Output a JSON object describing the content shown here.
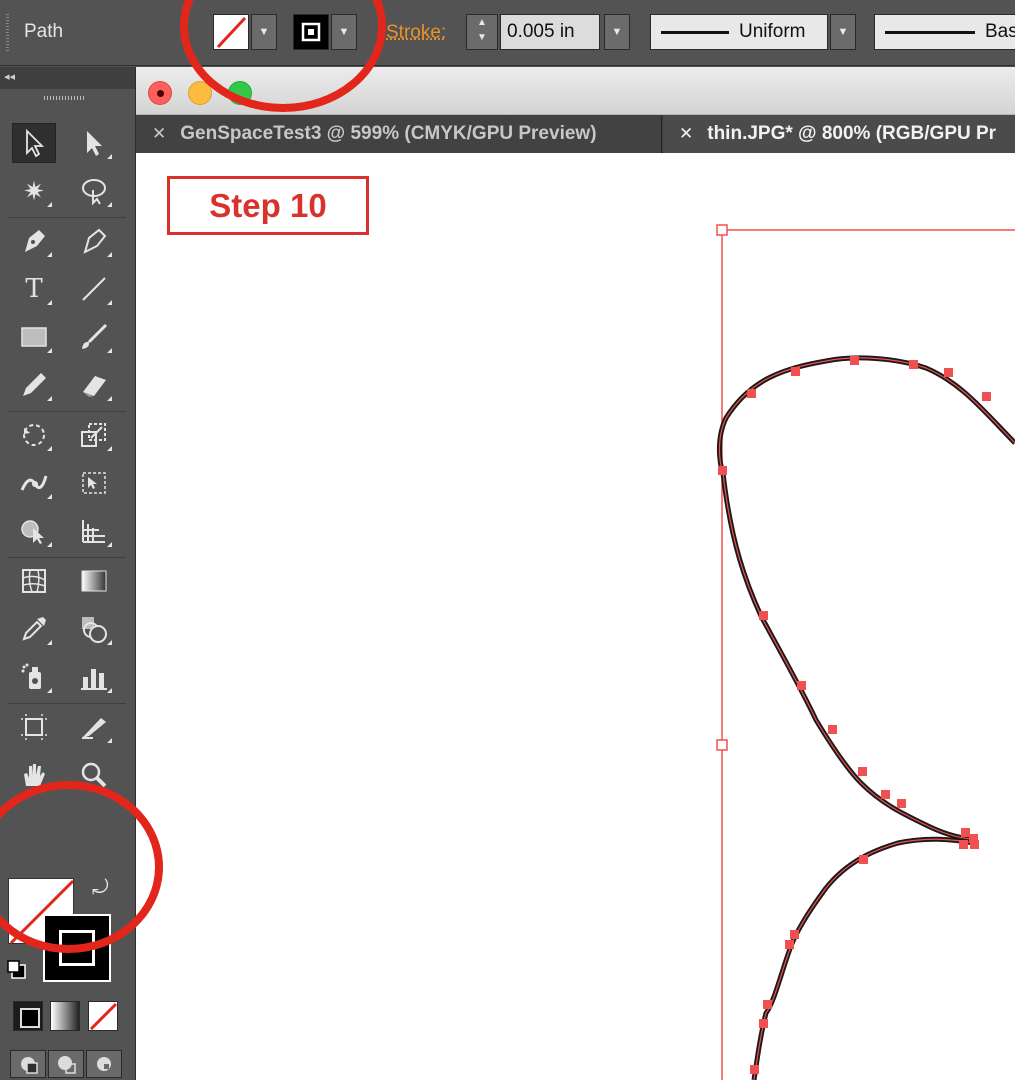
{
  "control_bar": {
    "selection_label": "Path",
    "stroke_label": "Stroke:",
    "stroke_weight": "0.005 in",
    "variable_width_profile": "Uniform",
    "brush_definition": "Bas"
  },
  "tools": [
    {
      "name": "selection-tool-icon"
    },
    {
      "name": "direct-selection-tool-icon"
    },
    {
      "name": "magic-wand-tool-icon"
    },
    {
      "name": "lasso-tool-icon"
    },
    {
      "name": "pen-tool-icon"
    },
    {
      "name": "curvature-tool-icon"
    },
    {
      "name": "type-tool-icon"
    },
    {
      "name": "line-segment-tool-icon"
    },
    {
      "name": "rectangle-tool-icon"
    },
    {
      "name": "paintbrush-tool-icon"
    },
    {
      "name": "pencil-tool-icon"
    },
    {
      "name": "eraser-tool-icon"
    },
    {
      "name": "rotate-tool-icon"
    },
    {
      "name": "scale-tool-icon"
    },
    {
      "name": "width-tool-icon"
    },
    {
      "name": "free-transform-tool-icon"
    },
    {
      "name": "shape-builder-tool-icon"
    },
    {
      "name": "perspective-grid-tool-icon"
    },
    {
      "name": "mesh-tool-icon"
    },
    {
      "name": "gradient-tool-icon"
    },
    {
      "name": "eyedropper-tool-icon"
    },
    {
      "name": "blend-tool-icon"
    },
    {
      "name": "symbol-sprayer-tool-icon"
    },
    {
      "name": "column-graph-tool-icon"
    },
    {
      "name": "artboard-tool-icon"
    },
    {
      "name": "slice-tool-icon"
    },
    {
      "name": "hand-tool-icon"
    },
    {
      "name": "zoom-tool-icon"
    }
  ],
  "document_tabs": [
    {
      "label": "GenSpaceTest3 @ 599% (CMYK/GPU Preview)",
      "active": false
    },
    {
      "label": "thin.JPG* @ 800% (RGB/GPU Pr",
      "active": true
    }
  ],
  "canvas": {
    "step_label": "Step 10"
  },
  "colors": {
    "annotation": "#e3261c",
    "step_label": "#d9322c",
    "path_selection": "#f0504f",
    "stroke_label": "#e8922b"
  }
}
